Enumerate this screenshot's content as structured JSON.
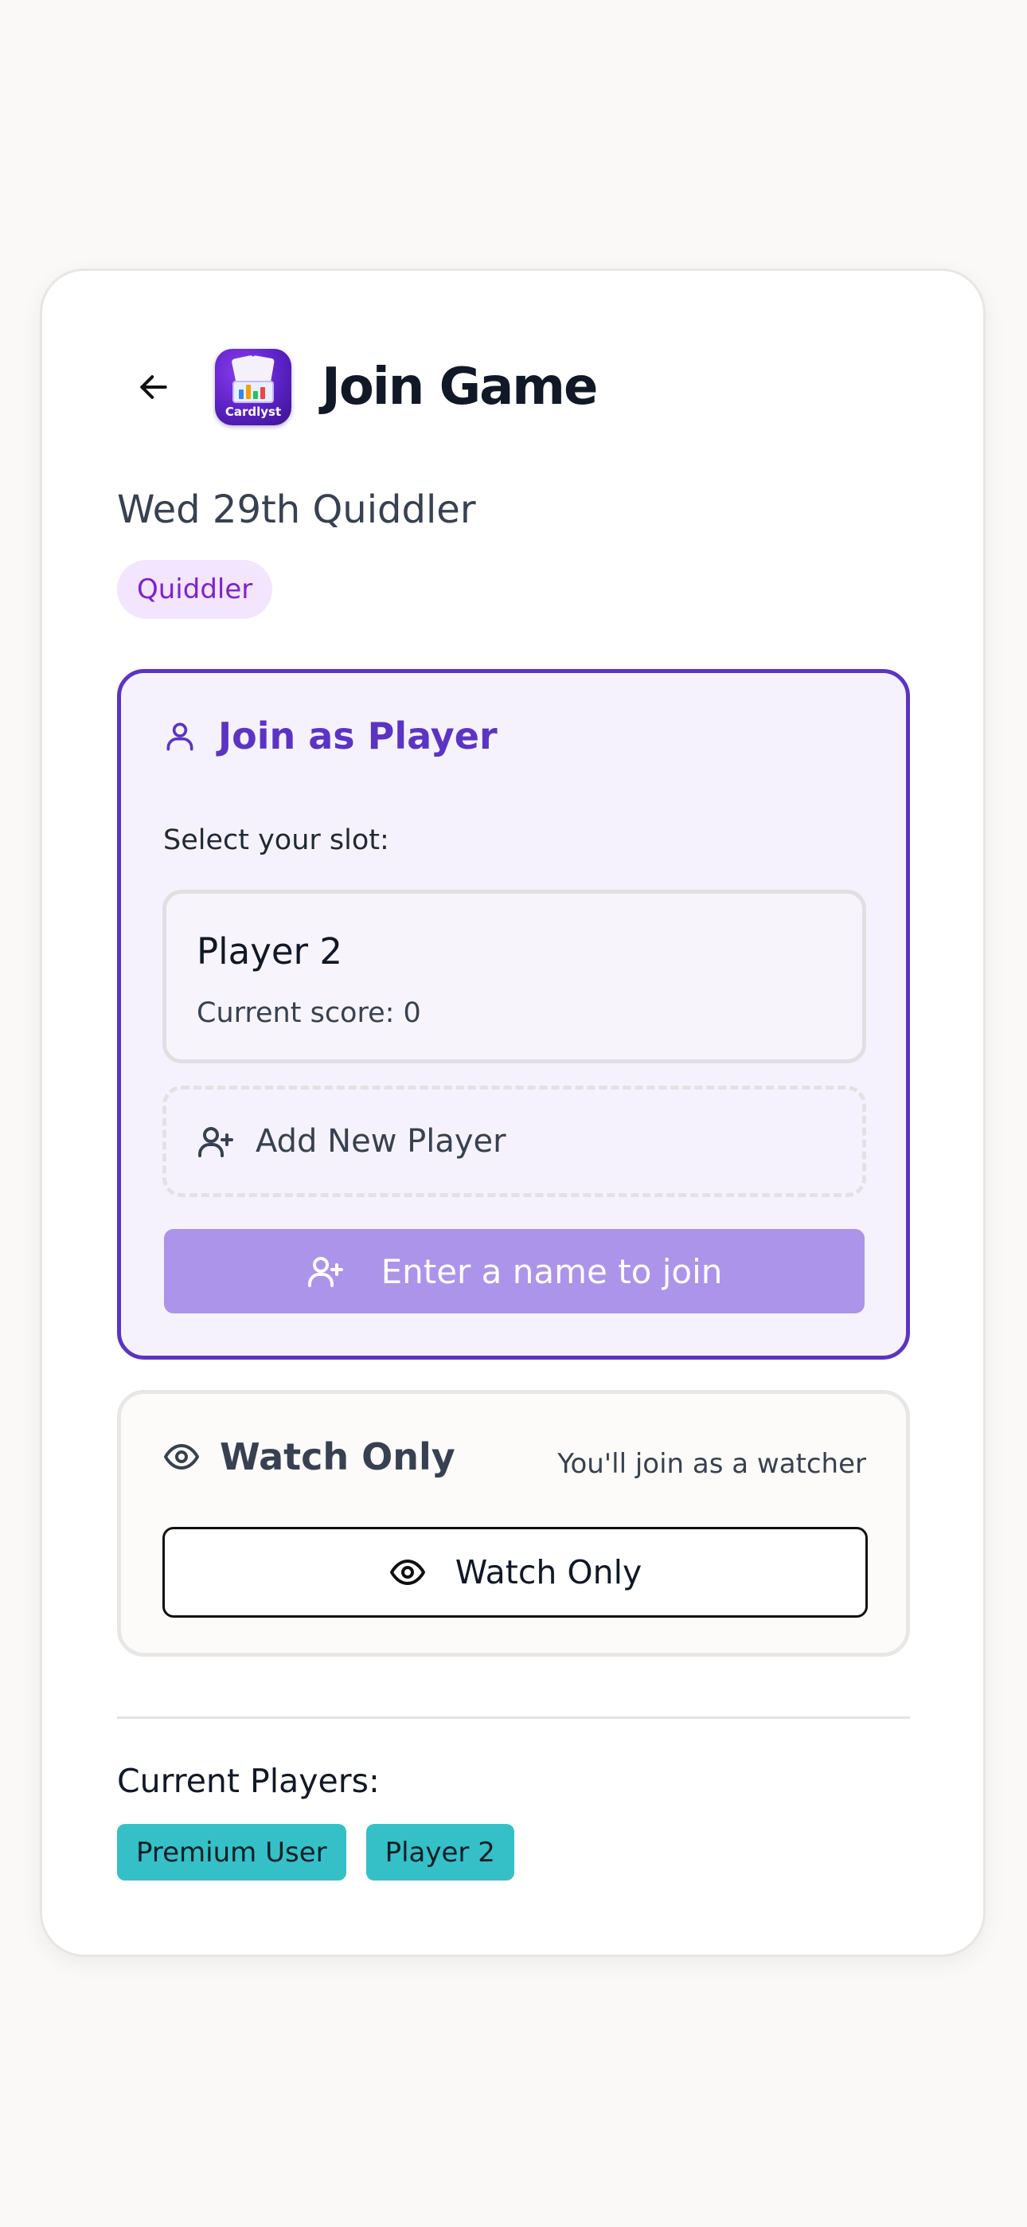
{
  "header": {
    "title": "Join Game",
    "back_icon": "arrow-left-icon",
    "logo_text": "Cardlyst"
  },
  "game": {
    "name": "Wed 29th Quiddler",
    "tag": "Quiddler"
  },
  "player_section": {
    "title": "Join as Player",
    "icon": "user-icon",
    "slot_label": "Select your slot:",
    "slots": [
      {
        "name": "Player 2",
        "score_text": "Current score: 0"
      }
    ],
    "add_new_label": "Add New Player",
    "join_button_label": "Enter a name to join"
  },
  "watch_section": {
    "title": "Watch Only",
    "icon": "eye-icon",
    "note": "You'll join as a watcher",
    "button_label": "Watch Only"
  },
  "current_players": {
    "label": "Current Players:",
    "players": [
      "Premium User",
      "Player 2"
    ]
  },
  "colors": {
    "accent": "#5b34c4",
    "accent_light_bg": "#f6f2fd",
    "join_button_bg": "#ab94ea",
    "tag_bg": "#f3e5fd",
    "tag_text": "#7e22ce",
    "chip_bg": "#35c0c8",
    "page_bg": "#faf9f7"
  }
}
